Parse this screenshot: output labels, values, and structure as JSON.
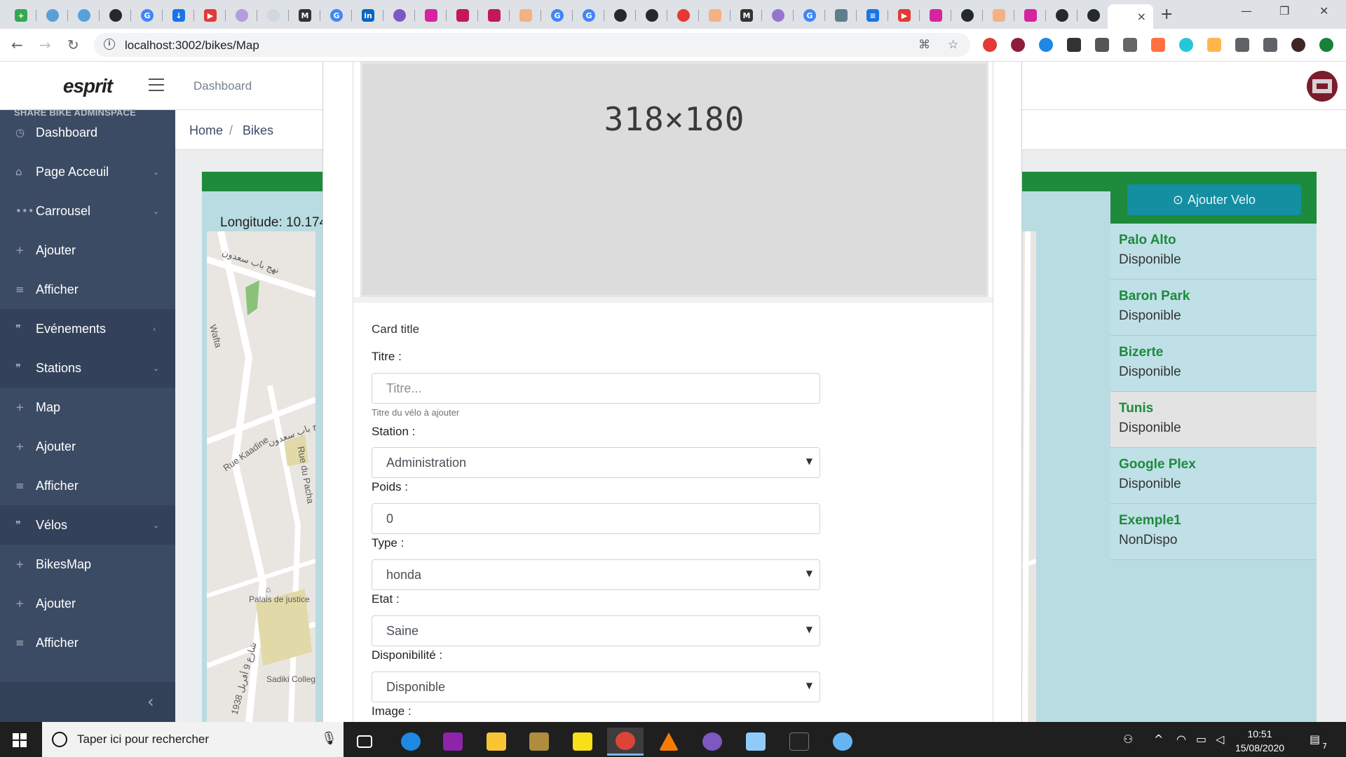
{
  "browser": {
    "url": "localhost:3002/bikes/Map",
    "tab_close": "×",
    "new_tab": "+",
    "window_controls": {
      "minimize": "—",
      "restore": "❐",
      "close": "✕"
    }
  },
  "app": {
    "brand": "esprit",
    "topbar_link": "Dashboard",
    "sidebar_title": "SHARE BIKE ADMINSPACE",
    "sidebar_items": [
      {
        "icon": "dashboard-icon",
        "glyph": "◷",
        "label": "Dashboard",
        "caret": ""
      },
      {
        "icon": "home-icon",
        "glyph": "⌂",
        "label": "Page Acceuil",
        "caret": "⌄"
      },
      {
        "icon": "dots-icon",
        "glyph": "•••",
        "label": "Carrousel",
        "caret": "⌄"
      },
      {
        "icon": "plus-icon",
        "glyph": "+",
        "label": "Ajouter",
        "caret": ""
      },
      {
        "icon": "list-icon",
        "glyph": "≡",
        "label": "Afficher",
        "caret": ""
      },
      {
        "icon": "quote-icon",
        "glyph": "❞",
        "label": "Evénements",
        "caret": "‹"
      },
      {
        "icon": "quote-icon",
        "glyph": "❞",
        "label": "Stations",
        "caret": "⌄"
      },
      {
        "icon": "plus-icon",
        "glyph": "+",
        "label": "Map",
        "caret": ""
      },
      {
        "icon": "plus-icon",
        "glyph": "+",
        "label": "Ajouter",
        "caret": ""
      },
      {
        "icon": "list-icon",
        "glyph": "≡",
        "label": "Afficher",
        "caret": ""
      },
      {
        "icon": "quote-icon",
        "glyph": "❞",
        "label": "Vélos",
        "caret": "⌄"
      },
      {
        "icon": "plus-icon",
        "glyph": "+",
        "label": "BikesMap",
        "caret": ""
      },
      {
        "icon": "plus-icon",
        "glyph": "+",
        "label": "Ajouter",
        "caret": ""
      },
      {
        "icon": "list-icon",
        "glyph": "≡",
        "label": "Afficher",
        "caret": ""
      }
    ],
    "sidebar_collapse": "‹",
    "breadcrumb": {
      "home": "Home",
      "sep": "/",
      "current": "Bikes"
    },
    "longitude_text": "Longitude: 10.174",
    "add_button": "Ajouter Velo",
    "bikes": [
      {
        "name": "Palo Alto",
        "status": "Disponible"
      },
      {
        "name": "Baron Park",
        "status": "Disponible"
      },
      {
        "name": "Bizerte",
        "status": "Disponible"
      },
      {
        "name": "Tunis",
        "status": "Disponible",
        "active": true
      },
      {
        "name": "Google Plex",
        "status": "Disponible"
      },
      {
        "name": "Exemple1",
        "status": "NonDispo"
      }
    ],
    "map_labels": {
      "street1": "Rue Kaadine",
      "street2": "Rue du Pacha",
      "poi1": "Palais de justice",
      "poi2": "Sadiki College",
      "street3": "Wafta",
      "street4": "شارع 9 أفريل 1938",
      "street5": "نهج باب سعدون",
      "street6": "نهج باب سعدون"
    }
  },
  "modal": {
    "placeholder_image_text": "318×180",
    "card_title": "Card title",
    "fields": {
      "titre_label": "Titre :",
      "titre_placeholder": "Titre...",
      "titre_help": "Titre du vélo à ajouter",
      "station_label": "Station :",
      "station_value": "Administration",
      "poids_label": "Poids :",
      "poids_value": "0",
      "type_label": "Type :",
      "type_value": "honda",
      "etat_label": "Etat :",
      "etat_value": "Saine",
      "dispo_label": "Disponibilité :",
      "dispo_value": "Disponible",
      "image_label": "Image :"
    }
  },
  "taskbar": {
    "search_placeholder": "Taper ici pour rechercher",
    "time": "10:51",
    "date": "15/08/2020",
    "notifications": "7"
  },
  "colors": {
    "sidebar_bg": "#3c4b64",
    "accent_green": "#1e8a3c",
    "button_teal": "#148ea1",
    "panel_bg": "#b9dbe2"
  }
}
